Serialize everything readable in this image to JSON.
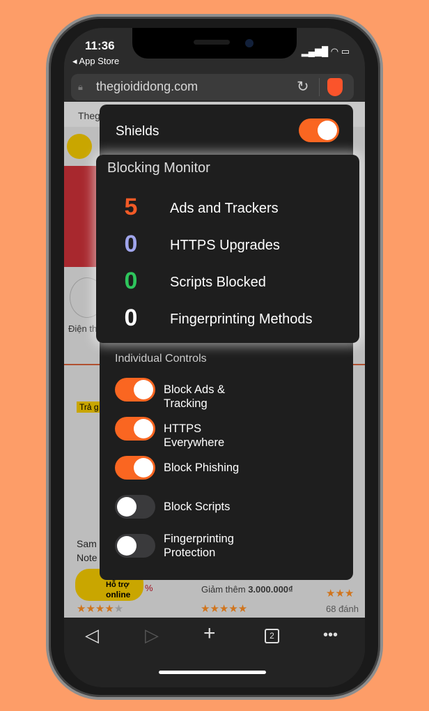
{
  "status": {
    "time": "11:36",
    "back_app": "App Store"
  },
  "browser": {
    "url": "thegioididong.com"
  },
  "page_behind": {
    "tab_text": "Theg",
    "category": "Điện th",
    "product_left": [
      "Sam",
      "Note"
    ],
    "badge_left": "Trả g",
    "support_text": [
      "Hỗ trợ",
      "online"
    ],
    "discount_mid": "Giảm thêm",
    "discount_amount": "3.000.000₫",
    "reviews_right": "68 đánh",
    "percent": "%"
  },
  "shields": {
    "label": "Shields",
    "enabled": true
  },
  "monitor": {
    "title": "Blocking Monitor",
    "stats": [
      {
        "count": "5",
        "label": "Ads and Trackers",
        "color": "#f25a26"
      },
      {
        "count": "0",
        "label": "HTTPS Upgrades",
        "color": "#a0a5eb"
      },
      {
        "count": "0",
        "label": "Scripts Blocked",
        "color": "#2ec55c"
      },
      {
        "count": "0",
        "label": "Fingerprinting Methods",
        "color": "#ffffff"
      }
    ]
  },
  "controls": {
    "title": "Individual Controls",
    "items": [
      {
        "label": "Block Ads & Tracking",
        "on": true
      },
      {
        "label": "HTTPS Everywhere",
        "on": true
      },
      {
        "label": "Block Phishing",
        "on": true
      },
      {
        "label": "Block Scripts",
        "on": false
      },
      {
        "label": "Fingerprinting Protection",
        "on": false
      }
    ]
  },
  "toolbar": {
    "tab_count": "2"
  },
  "colors": {
    "accent": "#fa6621",
    "background": "#fd9d68"
  }
}
